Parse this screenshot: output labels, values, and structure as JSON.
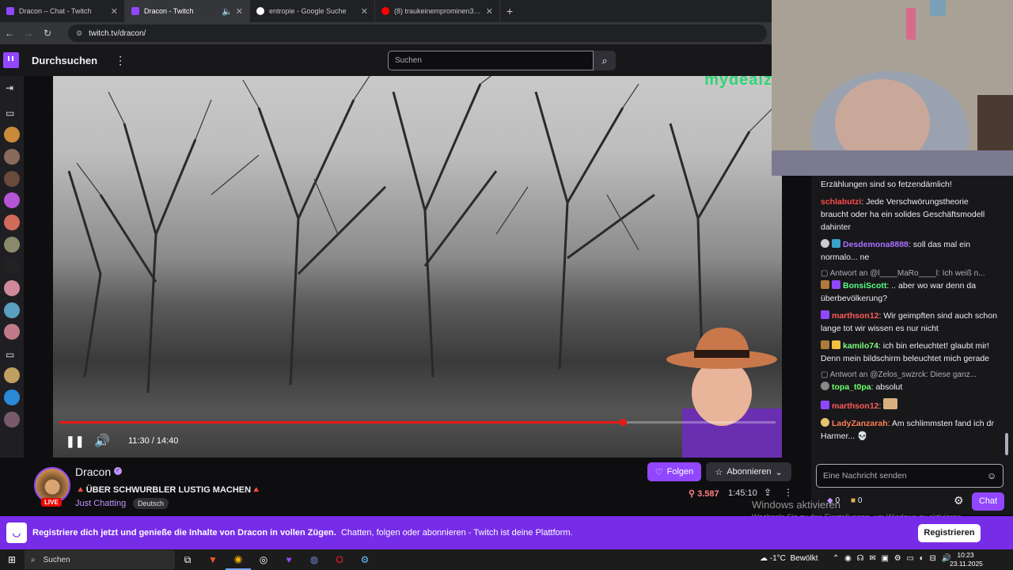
{
  "browser": {
    "tabs": [
      {
        "title": "Dracon – Chat - Twitch",
        "active": false,
        "color": "#9147ff"
      },
      {
        "title": "Dracon - Twitch",
        "active": true,
        "color": "#9147ff"
      },
      {
        "title": "entropie - Google Suche",
        "active": false,
        "color": "#4285f4"
      },
      {
        "title": "(8) traukeinemprominen3 - YouTube",
        "active": false,
        "color": "#ff0000"
      }
    ],
    "new_tab": "+",
    "url": "twitch.tv/dracon/"
  },
  "twitch_nav": {
    "browse": "Durchsuchen",
    "more": "⋮",
    "search_placeholder": "Suchen",
    "search_icon": "⌕"
  },
  "sidebar": {
    "expand_icon": "→|",
    "camera_icon": "▭"
  },
  "player": {
    "watermark": "mydealz",
    "time": "11:30 / 14:40",
    "progress": 0.787,
    "pause_icon": "❚❚",
    "volume_icon": "🔊"
  },
  "channel": {
    "name": "Dracon",
    "live": "LIVE",
    "title": "🔺ÜBER SCHWURBLER LUSTIG MACHEN🔺",
    "category": "Just Chatting",
    "language": "Deutsch",
    "follow": "Folgen",
    "subscribe": "Abonnieren",
    "viewers": "3.587",
    "uptime": "1:45:10"
  },
  "chat": {
    "messages": [
      {
        "type": "text",
        "text": "Erzählungen sind so fetzendämlich!"
      },
      {
        "type": "msg",
        "user": "schlabutzi",
        "color": "#ff4a4a",
        "text": "Jede Verschwörungstheorie braucht oder ha ein solides Geschäftsmodell dahinter"
      },
      {
        "type": "msg",
        "user": "Desdemona8888",
        "color": "#a970ff",
        "text": "soll das mal ein normalo... ne"
      },
      {
        "type": "reply",
        "text": "Antwort an @l____MaRo____l: Ich weiß n..."
      },
      {
        "type": "msg",
        "user": "BonsiScott",
        "color": "#57ff86",
        "text": ".. aber wo war denn da überbevölkerung?"
      },
      {
        "type": "msg",
        "user": "marthson12",
        "color": "#ff5a5a",
        "text": "Wir geimpften sind auch schon lange tot wir wissen es nur nicht"
      },
      {
        "type": "msg",
        "user": "kamilo74",
        "color": "#7cfc7c",
        "text": "ich bin erleuchtet! glaubt mir! Denn mein bildschirm beleuchtet mich gerade"
      },
      {
        "type": "reply",
        "text": "Antwort an @Zelos_swzrck: Diese ganz..."
      },
      {
        "type": "msg",
        "user": "topa_t0pa",
        "color": "#6bff6b",
        "text": "absolut"
      },
      {
        "type": "msg",
        "user": "marthson12",
        "color": "#ff5a5a",
        "text": ""
      },
      {
        "type": "msg",
        "user": "LadyZanzarah",
        "color": "#ff7f50",
        "text": "Am schlimmsten fand ich dr Harmer... 💀"
      }
    ],
    "input_placeholder": "Eine Nachricht senden",
    "points_a": "0",
    "points_b": "0",
    "chat_button": "Chat"
  },
  "windows_activation": {
    "line1": "Windows aktivieren",
    "line2": "Wechseln Sie zu den Einstellungen, um Windows zu aktivieren."
  },
  "banner": {
    "bold_text": "Registriere dich jetzt und genieße die Inhalte von Dracon in vollen Zügen.",
    "text": "Chatten, folgen oder abonnieren - Twitch ist deine Plattform.",
    "register": "Registrieren"
  },
  "taskbar": {
    "search": "Suchen",
    "temperature": "-1°C",
    "weather_text": "Bewölkt",
    "time": "10:23",
    "date": "23.11.2025"
  }
}
